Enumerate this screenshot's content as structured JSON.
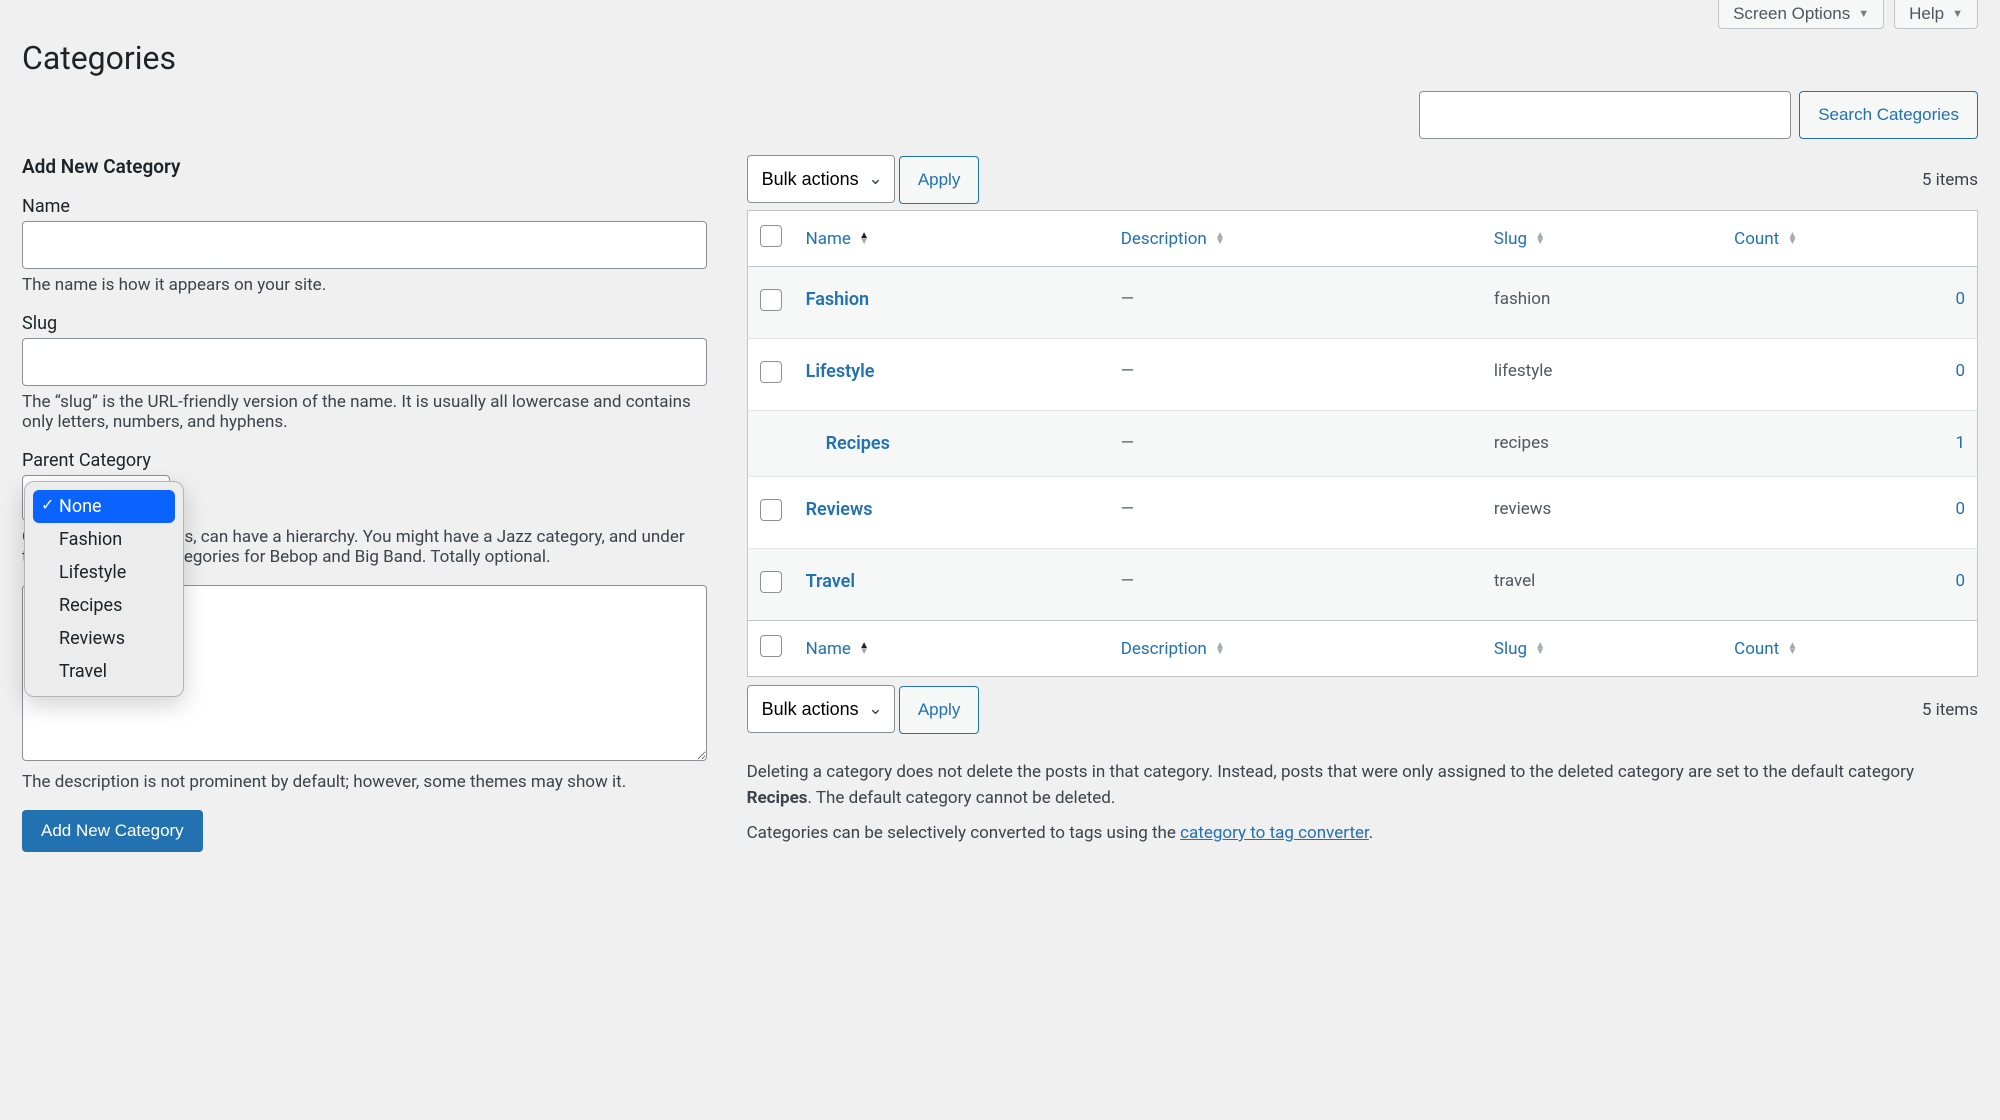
{
  "top": {
    "screen_options": "Screen Options",
    "help": "Help"
  },
  "page_title": "Categories",
  "search": {
    "button": "Search Categories"
  },
  "form": {
    "heading": "Add New Category",
    "name_label": "Name",
    "name_help": "The name is how it appears on your site.",
    "slug_label": "Slug",
    "slug_help": "The “slug” is the URL-friendly version of the name. It is usually all lowercase and contains only letters, numbers, and hyphens.",
    "parent_label": "Parent Category",
    "parent_help": "Categories, unlike tags, can have a hierarchy. You might have a Jazz category, and under that have children categories for Bebop and Big Band. Totally optional.",
    "desc_help": "The description is not prominent by default; however, some themes may show it.",
    "submit": "Add New Category"
  },
  "parent_options": [
    {
      "label": "None",
      "selected": true
    },
    {
      "label": "Fashion",
      "selected": false
    },
    {
      "label": "Lifestyle",
      "selected": false
    },
    {
      "label": "Recipes",
      "selected": false
    },
    {
      "label": "Reviews",
      "selected": false
    },
    {
      "label": "Travel",
      "selected": false
    }
  ],
  "bulk": {
    "label": "Bulk actions",
    "apply": "Apply"
  },
  "items_count": "5 items",
  "columns": {
    "name": "Name",
    "description": "Description",
    "slug": "Slug",
    "count": "Count"
  },
  "rows": [
    {
      "name": "Fashion",
      "description": "—",
      "slug": "fashion",
      "count": "0",
      "child": false
    },
    {
      "name": "Lifestyle",
      "description": "—",
      "slug": "lifestyle",
      "count": "0",
      "child": false
    },
    {
      "name": "Recipes",
      "description": "—",
      "slug": "recipes",
      "count": "1",
      "child": true
    },
    {
      "name": "Reviews",
      "description": "—",
      "slug": "reviews",
      "count": "0",
      "child": false
    },
    {
      "name": "Travel",
      "description": "—",
      "slug": "travel",
      "count": "0",
      "child": false
    }
  ],
  "notes": {
    "p1a": "Deleting a category does not delete the posts in that category. Instead, posts that were only assigned to the deleted category are set to the default category ",
    "p1b": "Recipes",
    "p1c": ". The default category cannot be deleted.",
    "p2a": "Categories can be selectively converted to tags using the ",
    "p2_link": "category to tag converter",
    "p2b": "."
  }
}
